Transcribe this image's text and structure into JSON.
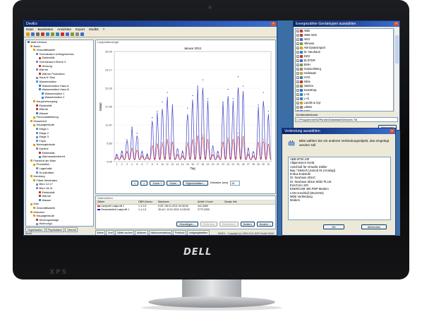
{
  "brand": {
    "logo": "DELL",
    "model": "XPS"
  },
  "main_window": {
    "title": "DeviEx",
    "menu": [
      "Datei",
      "Bearbeiten",
      "Ansichten",
      "Export",
      "Modbit",
      "?"
    ],
    "toolbar_icons": [
      "open-icon",
      "save-icon",
      "print-icon",
      "cut-icon",
      "copy-icon",
      "paste-icon",
      "refresh-icon",
      "chart-icon",
      "table-icon",
      "export-icon",
      "settings-icon",
      "help-icon"
    ],
    "tree": [
      {
        "label": "Walt Kirchner",
        "depth": 0,
        "color": "#3a6ed0"
      },
      {
        "label": "Berlin",
        "depth": 1,
        "color": "#d4a017"
      },
      {
        "label": "Geschäftsstelle",
        "depth": 2,
        "color": "#d4a017"
      },
      {
        "label": "Technikraum Untergeschoss",
        "depth": 3,
        "color": "#6f8fbf"
      },
      {
        "label": "Elektrizität",
        "depth": 4,
        "color": "#c0392b"
      },
      {
        "label": "Technikraum Ebene 3",
        "depth": 3,
        "color": "#6f8fbf"
      },
      {
        "label": "Heizung",
        "depth": 4,
        "color": "#c0392b"
      },
      {
        "label": "Wärme",
        "depth": 3,
        "color": "#6f8fbf"
      },
      {
        "label": "Wärme Produktion",
        "depth": 4,
        "color": "#c0392b"
      },
      {
        "label": "Haus A / Bau",
        "depth": 3,
        "color": "#6f8fbf"
      },
      {
        "label": "Wasserstation",
        "depth": 3,
        "color": "#6f8fbf"
      },
      {
        "label": "Wasserstation Haus A",
        "depth": 4,
        "color": "#2e86c1"
      },
      {
        "label": "Wasserstation Haus B",
        "depth": 4,
        "color": "#2e86c1"
      },
      {
        "label": "Wasserstation 1",
        "depth": 5,
        "color": "#2e86c1"
      },
      {
        "label": "Wasserstation 2",
        "depth": 5,
        "color": "#2e86c1"
      },
      {
        "label": "Hauptversorgung",
        "depth": 2,
        "color": "#d4a017"
      },
      {
        "label": "Elektrizität",
        "depth": 3,
        "color": "#c0392b"
      },
      {
        "label": "Wärme",
        "depth": 3,
        "color": "#c0392b"
      },
      {
        "label": "Wasser",
        "depth": 3,
        "color": "#2e86c1"
      },
      {
        "label": "Personalabteilung",
        "depth": 2,
        "color": "#d4a017"
      },
      {
        "label": "Düsseldorf",
        "depth": 1,
        "color": "#d4a017"
      },
      {
        "label": "Hauptgebäude",
        "depth": 2,
        "color": "#d4a017"
      },
      {
        "label": "Etage 1",
        "depth": 3,
        "color": "#6f8fbf"
      },
      {
        "label": "Etage 2",
        "depth": 3,
        "color": "#6f8fbf"
      },
      {
        "label": "Etage 3",
        "depth": 3,
        "color": "#6f8fbf"
      },
      {
        "label": "Foyer",
        "depth": 3,
        "color": "#6f8fbf"
      },
      {
        "label": "Nebengebäude",
        "depth": 2,
        "color": "#d4a017"
      },
      {
        "label": "Kantine",
        "depth": 3,
        "color": "#6f8fbf"
      },
      {
        "label": "Elektrizität",
        "depth": 4,
        "color": "#c0392b"
      },
      {
        "label": "Warmwasserbereit.",
        "depth": 4,
        "color": "#2e86c1"
      },
      {
        "label": "Frankfurt am Main",
        "depth": 1,
        "color": "#d4a017"
      },
      {
        "label": "Produktion",
        "depth": 2,
        "color": "#d4a017"
      },
      {
        "label": "Lagerhalle",
        "depth": 3,
        "color": "#6f8fbf"
      },
      {
        "label": "Druckluftanl.",
        "depth": 3,
        "color": "#6f8fbf"
      },
      {
        "label": "Hamburg",
        "depth": 1,
        "color": "#d4a017"
      },
      {
        "label": "Filiale Westhafen",
        "depth": 2,
        "color": "#d4a017"
      },
      {
        "label": "Büro 12-17",
        "depth": 3,
        "color": "#6f8fbf"
      },
      {
        "label": "Büro 18-31",
        "depth": 3,
        "color": "#6f8fbf"
      },
      {
        "label": "Elektrizität",
        "depth": 4,
        "color": "#c0392b"
      },
      {
        "label": "Wärme",
        "depth": 4,
        "color": "#c0392b"
      },
      {
        "label": "Wasser",
        "depth": 4,
        "color": "#2e86c1"
      },
      {
        "label": "Köln",
        "depth": 1,
        "color": "#d4a017"
      },
      {
        "label": "Geschäftsstelle",
        "depth": 2,
        "color": "#d4a017"
      },
      {
        "label": "München",
        "depth": 1,
        "color": "#d4a017"
      },
      {
        "label": "Hauptgebäude",
        "depth": 2,
        "color": "#d4a017"
      },
      {
        "label": "Heizungsanlage",
        "depth": 3,
        "color": "#c0392b"
      },
      {
        "label": "Wohnung1",
        "depth": 3,
        "color": "#6f8fbf"
      }
    ],
    "tree_tabs": [
      "Organisation",
      "Physikalisch",
      "Überall"
    ],
    "chart_caption": "Lastprofilanzeige",
    "controls": {
      "prev": "<",
      "next": ">",
      "zoom_in": "Zoom +",
      "zoom_out": "Zoom -",
      "properties": "Eigenschaften...",
      "interval_label": "Zeitraster [min]",
      "interval_value": "15"
    },
    "datapoints": {
      "caption": "Datenreihen",
      "headers": [
        "Zähler",
        "OBIS-Kennz.",
        "Maximum",
        "Arbeit / Kurve",
        "Zusatz Info"
      ],
      "rows": [
        {
          "swatch": "#d62728",
          "cells": [
            "Lastprofil Lastprofil 1",
            "1-1:1.5",
            "9,00 / 08.01.2011 00:45:30",
            "441,5360",
            ""
          ]
        },
        {
          "swatch": "#1f1fbf",
          "cells": [
            "Gesamtarbeit Lastprofil 1",
            "1-1:1.5",
            "30,44 / 12.01.2011 14:30:00",
            "2770,3200",
            ""
          ]
        }
      ],
      "buttons": [
        "Hinzufügen...",
        "Entfernen",
        "Bearbeiten",
        "Ändern",
        "Ändern ↓"
      ]
    },
    "taskbar": [
      "Werte",
      "Graf",
      "Zähler suchen",
      "Aktionen",
      "Aktionsverwaltung",
      "Protokoll",
      "Lastgangtabellen"
    ],
    "status_left": "Bereit",
    "status_right": "DiDEX - Copyright (c) 1999-2011 NZR GmbH   NUM"
  },
  "chart_data": {
    "type": "line",
    "title": "Januar 2011",
    "xlabel": "Tag",
    "ylabel": "kWatt",
    "ylim": [
      0,
      30.44
    ],
    "yticks": [
      0,
      5.85,
      11.67,
      17.5,
      23.33,
      29.17,
      35.0
    ],
    "ytick_labels": [
      "0.00",
      "5.83",
      "11.67",
      "17.50",
      "23.33",
      "29.17",
      "35.00"
    ],
    "x": [
      1,
      2,
      3,
      4,
      5,
      6,
      7,
      8,
      9,
      10,
      11,
      12,
      13,
      14,
      15,
      16,
      17,
      18,
      19,
      20,
      21,
      22,
      23,
      24,
      25,
      26,
      27,
      28,
      29,
      30,
      31
    ],
    "series": [
      {
        "name": "Gesamtarbeit Lastprofil 1",
        "color": "#1f1fbf",
        "values": [
          2,
          3,
          7,
          11,
          9,
          3,
          2,
          14,
          16,
          19,
          22,
          18,
          4,
          3,
          17,
          21,
          24,
          26,
          20,
          5,
          3,
          19,
          23,
          20,
          27,
          24,
          4,
          3,
          18,
          22,
          16
        ]
      },
      {
        "name": "Lastprofil Lastprofil 1",
        "color": "#d62728",
        "values": [
          1,
          1.5,
          3,
          4,
          3.5,
          1.5,
          1,
          5,
          5.5,
          6,
          7,
          6,
          2,
          1.5,
          6,
          7,
          8,
          8.5,
          7,
          2,
          1.5,
          6,
          7.5,
          7,
          9,
          8,
          2,
          1.5,
          6,
          7,
          5.5
        ]
      }
    ]
  },
  "device_window": {
    "title": "Energiezähler-Gerätetypen auswählen",
    "devices": [
      "ABB",
      "ABB-AEG",
      "AEG",
      "Allmess",
      "AW Datenimport",
      "Dr. Neuhaus",
      "DZG",
      "ELSTER",
      "EMH",
      "Gossen/Berg",
      "Hellowatt",
      "HYD",
      "Iskra",
      "Janitza",
      "Kamstrup",
      "L+G",
      "L+S",
      "Landis & Gyr",
      "Littwin",
      "NZR",
      "NZR-LON",
      "NZR-M-Bus",
      "Schlumberger",
      "Siemens"
    ],
    "db_label": "Gerätedatenbank:",
    "db_path": "C:\\Programme\\NZR\\index\\Database\\Devices.Tdl",
    "cancel": "Abbrechen"
  },
  "connection_dialog": {
    "title": "Verbindung auswählen",
    "message": "Bitte wählen Sie ein anderes Verbindungsobjekt, das eingelegt werden soll",
    "options": [
      "ABB MTM 100",
      "Allgemeines Gerät",
      "Anschluß für Virtuelle Zähler",
      "Bay / Dietrich (Jumod 01 (Analog))",
      "D-Bus Endstufe",
      "Dr. Neuhaus 2DLIC",
      "Dr. Neuhaus ZDUe MOD PLUS",
      "EnerCom 100",
      "ENERCOM 400 PNP-Modem",
      "LON Anschluß (WLDV02)",
      "MDE Verbindung",
      "Modem"
    ],
    "ok": "OK",
    "cancel": "Abbrechen"
  }
}
